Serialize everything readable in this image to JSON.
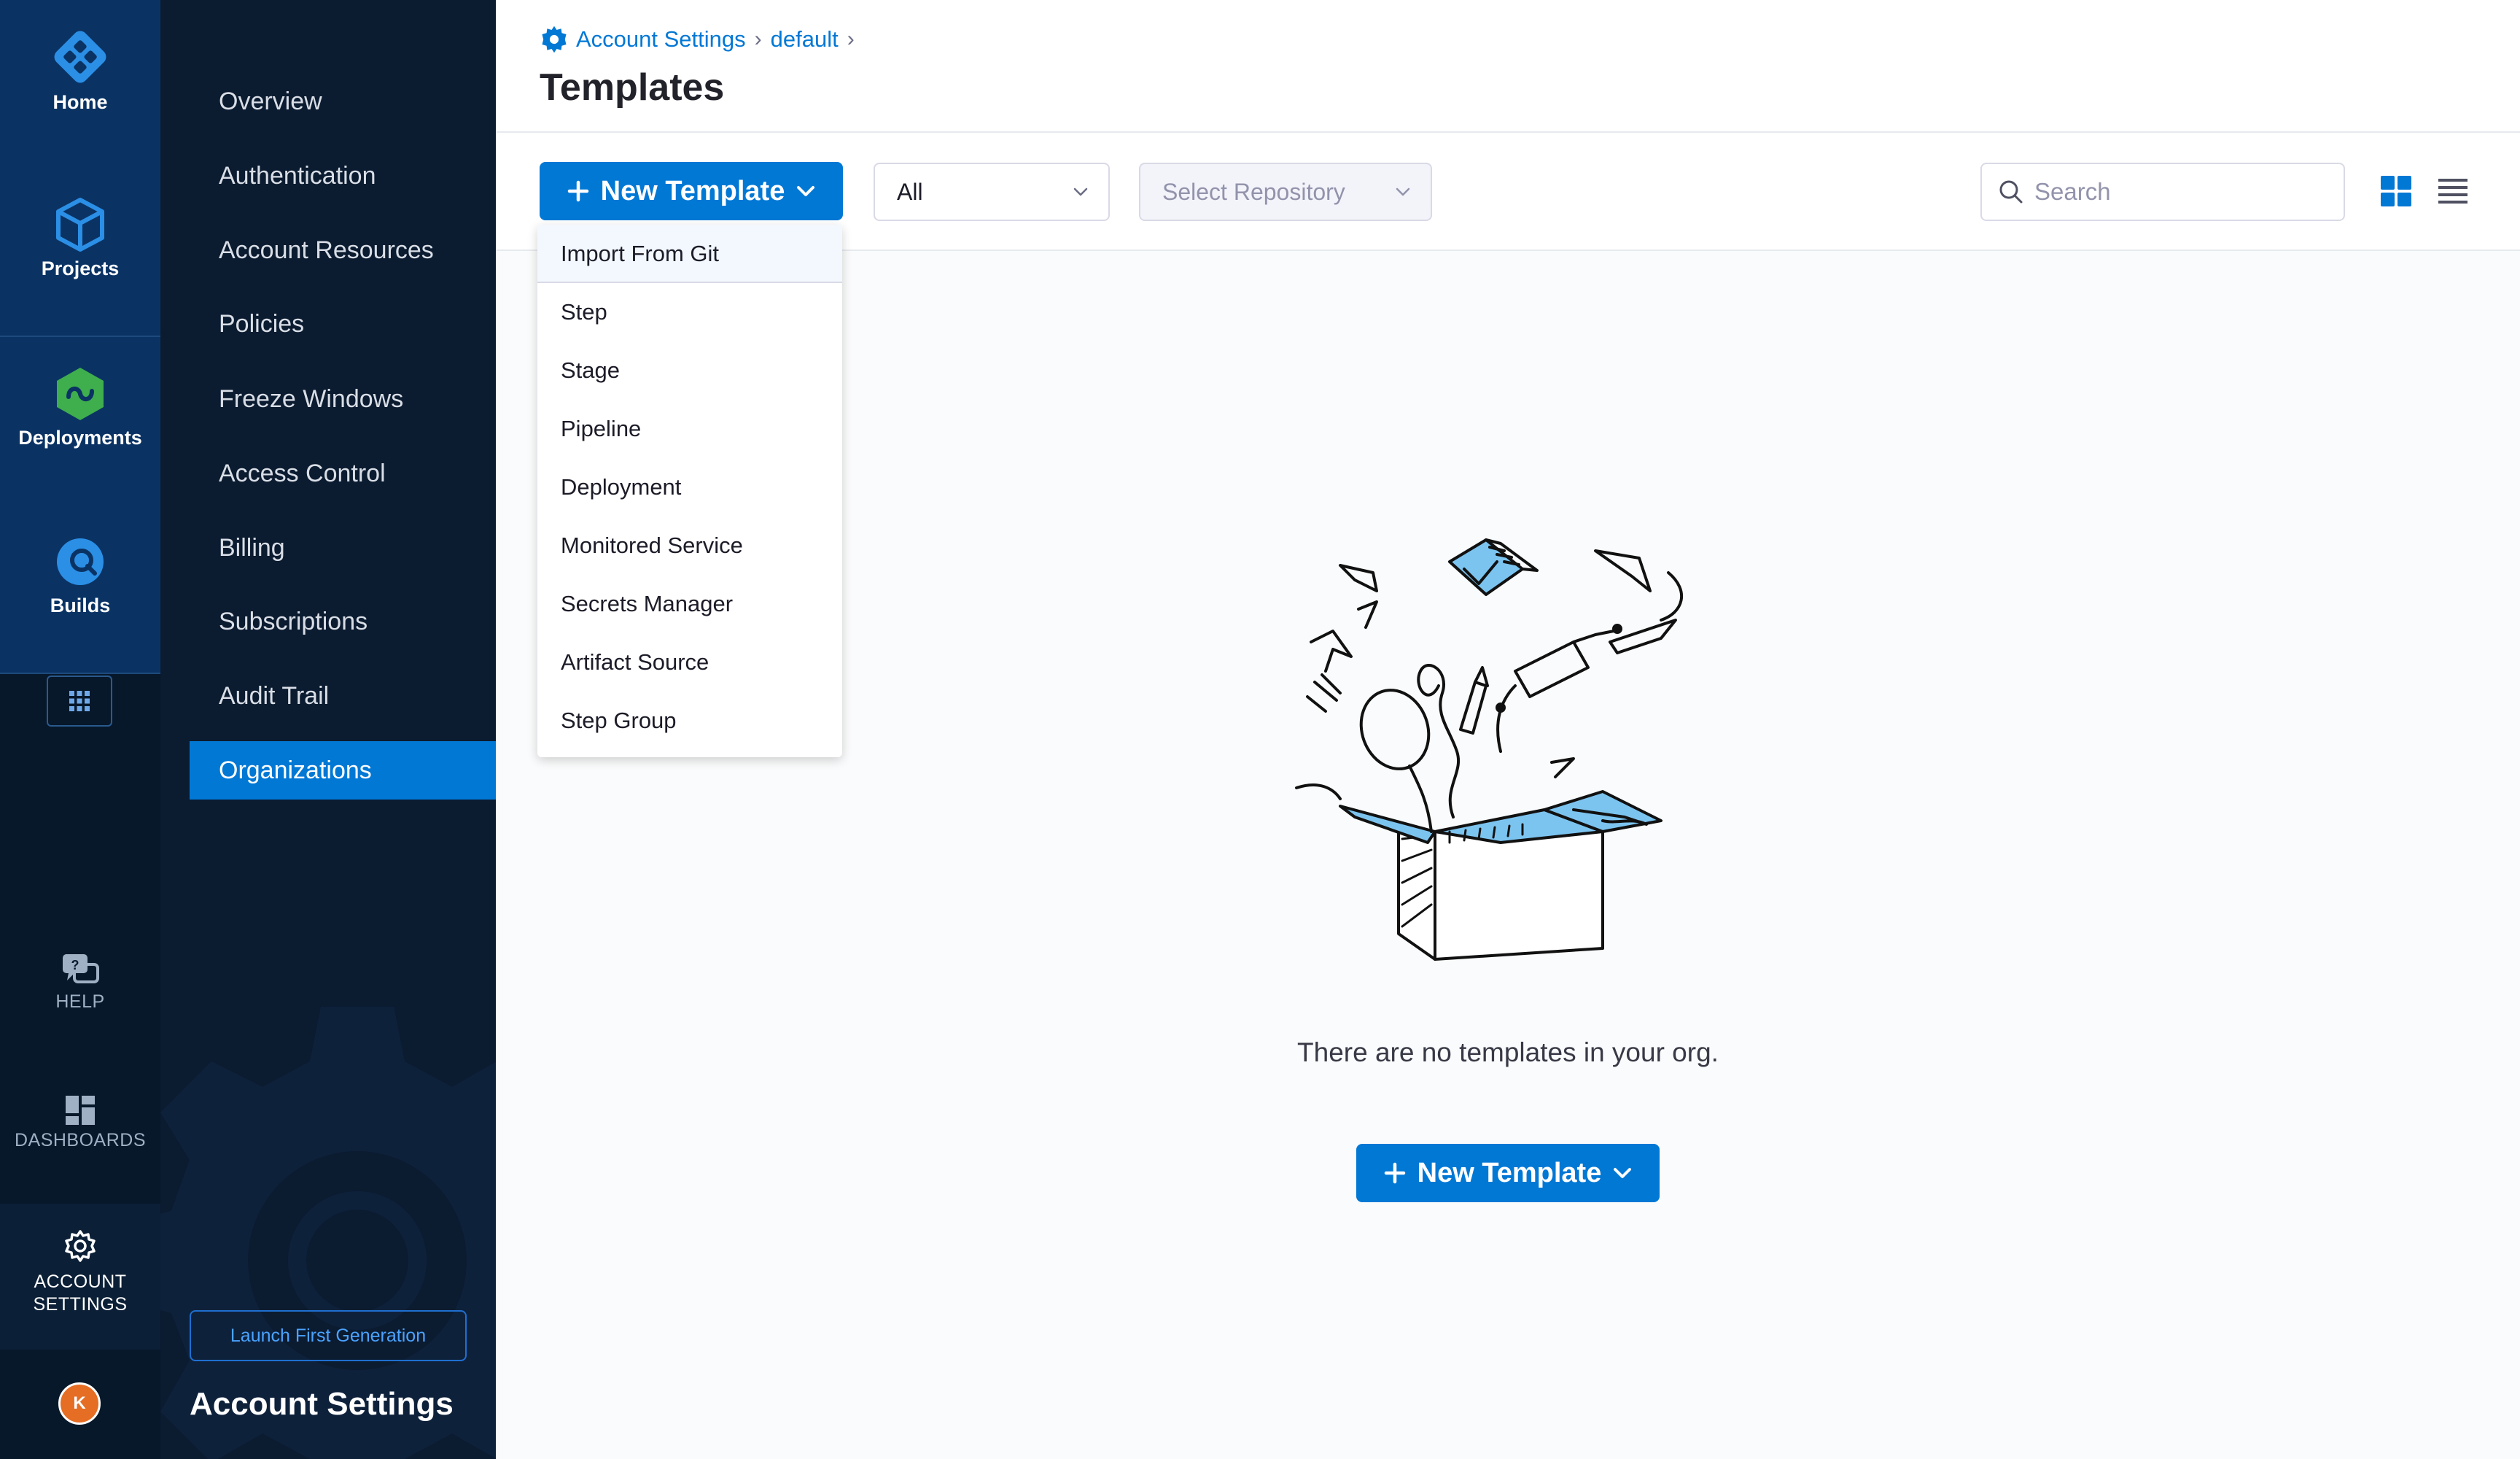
{
  "rail": {
    "items": [
      {
        "label": "Home"
      },
      {
        "label": "Projects"
      },
      {
        "label": "Deployments"
      },
      {
        "label": "Builds"
      }
    ],
    "help_label": "HELP",
    "dashboards_label": "DASHBOARDS",
    "account_settings_label": "ACCOUNT SETTINGS",
    "avatar_initial": "K"
  },
  "subnav": {
    "items": [
      {
        "label": "Overview"
      },
      {
        "label": "Authentication"
      },
      {
        "label": "Account Resources"
      },
      {
        "label": "Policies"
      },
      {
        "label": "Freeze Windows"
      },
      {
        "label": "Access Control"
      },
      {
        "label": "Billing"
      },
      {
        "label": "Subscriptions"
      },
      {
        "label": "Audit Trail"
      },
      {
        "label": "Organizations"
      }
    ],
    "active_item": "Organizations",
    "launch_button": "Launch First Generation",
    "title": "Account Settings"
  },
  "breadcrumb": {
    "items": [
      "Account Settings",
      "default"
    ]
  },
  "page": {
    "title": "Templates"
  },
  "toolbar": {
    "new_template_label": "New Template",
    "type_filter_value": "All",
    "repo_select_placeholder": "Select Repository",
    "search_placeholder": "Search",
    "view_mode": "grid"
  },
  "new_template_menu": {
    "items": [
      "Import From Git",
      "Step",
      "Stage",
      "Pipeline",
      "Deployment",
      "Monitored Service",
      "Secrets Manager",
      "Artifact Source",
      "Step Group"
    ]
  },
  "empty_state": {
    "message": "There are no templates in your org.",
    "button_label": "New Template"
  },
  "colors": {
    "accent": "#0278d5",
    "rail_bg": "#0a3364",
    "subnav_bg": "#0b1b30",
    "deployments_icon": "#3fae4c",
    "avatar_bg": "#e56d24"
  }
}
